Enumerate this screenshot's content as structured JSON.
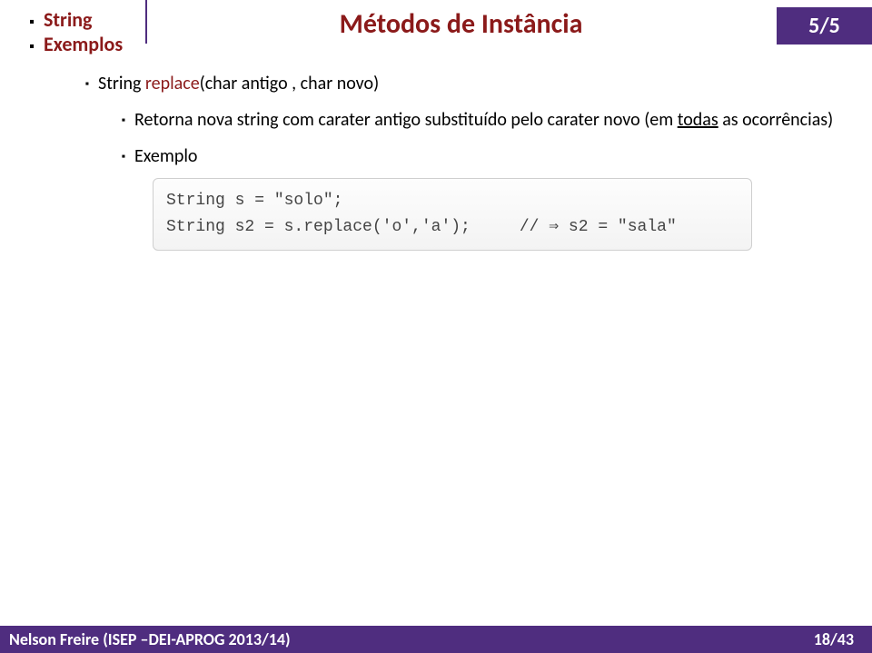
{
  "header": {
    "topic": "String",
    "subtopic": "Exemplos",
    "title": "Métodos de Instância",
    "page_ind": "5/5"
  },
  "content": {
    "signature_prefix": "String ",
    "signature_method": "replace",
    "signature_suffix": "(char antigo , char novo)",
    "desc_prefix": "Retorna nova string com carater antigo substituído pelo carater novo (em ",
    "desc_under": "todas",
    "desc_suffix": " as ocorrências)",
    "example_label": "Exemplo",
    "code_line1": "String s = \"solo\";",
    "code_line2_left": "String s2 = s.replace('o','a');",
    "code_line2_arrow": "⇒",
    "code_line2_right": " s2 = \"sala\""
  },
  "footer": {
    "left": "Nelson Freire (ISEP –DEI-APROG 2013/14)",
    "right": "18/43"
  }
}
